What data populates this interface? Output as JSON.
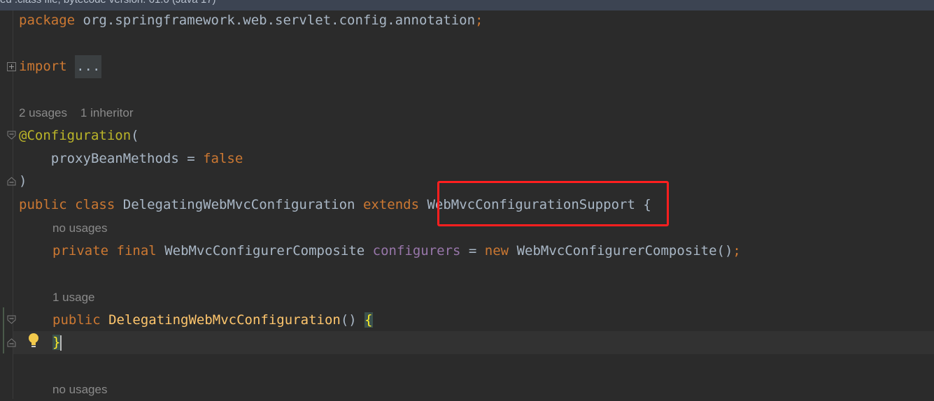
{
  "window": {
    "decompiled_banner": "ed .class file, bytecode version: 61.0 (Java 17)"
  },
  "editor": {
    "lines": {
      "package_kw": "package",
      "package_name": " org.springframework.web.servlet.config.annotation",
      "package_semi": ";",
      "import_kw": "import",
      "import_folded": "...",
      "annotation": "@Configuration",
      "annotation_paren_open": "(",
      "proxy_indent": "    ",
      "proxy_param": "proxyBeanMethods = ",
      "proxy_value": "false",
      "annotation_paren_close": ")",
      "class_public": "public",
      "class_kw": "class",
      "class_name": "DelegatingWebMvcConfiguration",
      "extends_kw": "extends",
      "superclass": "WebMvcConfigurationSupport",
      "class_brace": "{",
      "field_private": "private",
      "field_final": "final",
      "field_type": "WebMvcConfigurerComposite",
      "field_name": "configurers",
      "field_eq": " = ",
      "field_new": "new",
      "field_init": " WebMvcConfigurerComposite()",
      "field_semi": ";",
      "ctor_public": "public",
      "ctor_name": "DelegatingWebMvcConfiguration",
      "ctor_parens": "() ",
      "ctor_open": "{",
      "ctor_close": "}"
    },
    "inlays": {
      "class_usages": "2 usages",
      "class_inheritors": "1 inheritor",
      "field_usages": "no usages",
      "ctor_usages": "1 usage",
      "next_usages": "no usages"
    },
    "colors": {
      "background": "#2b2b2b",
      "keyword": "#cc7832",
      "annotation": "#bbb529",
      "method": "#ffc66d",
      "field": "#9876aa",
      "text": "#a9b7c6",
      "highlight_box": "#ff1f1f"
    },
    "icons": [
      "fold-plus-icon",
      "fold-open-icon",
      "fold-close-icon",
      "lightbulb-icon"
    ]
  }
}
